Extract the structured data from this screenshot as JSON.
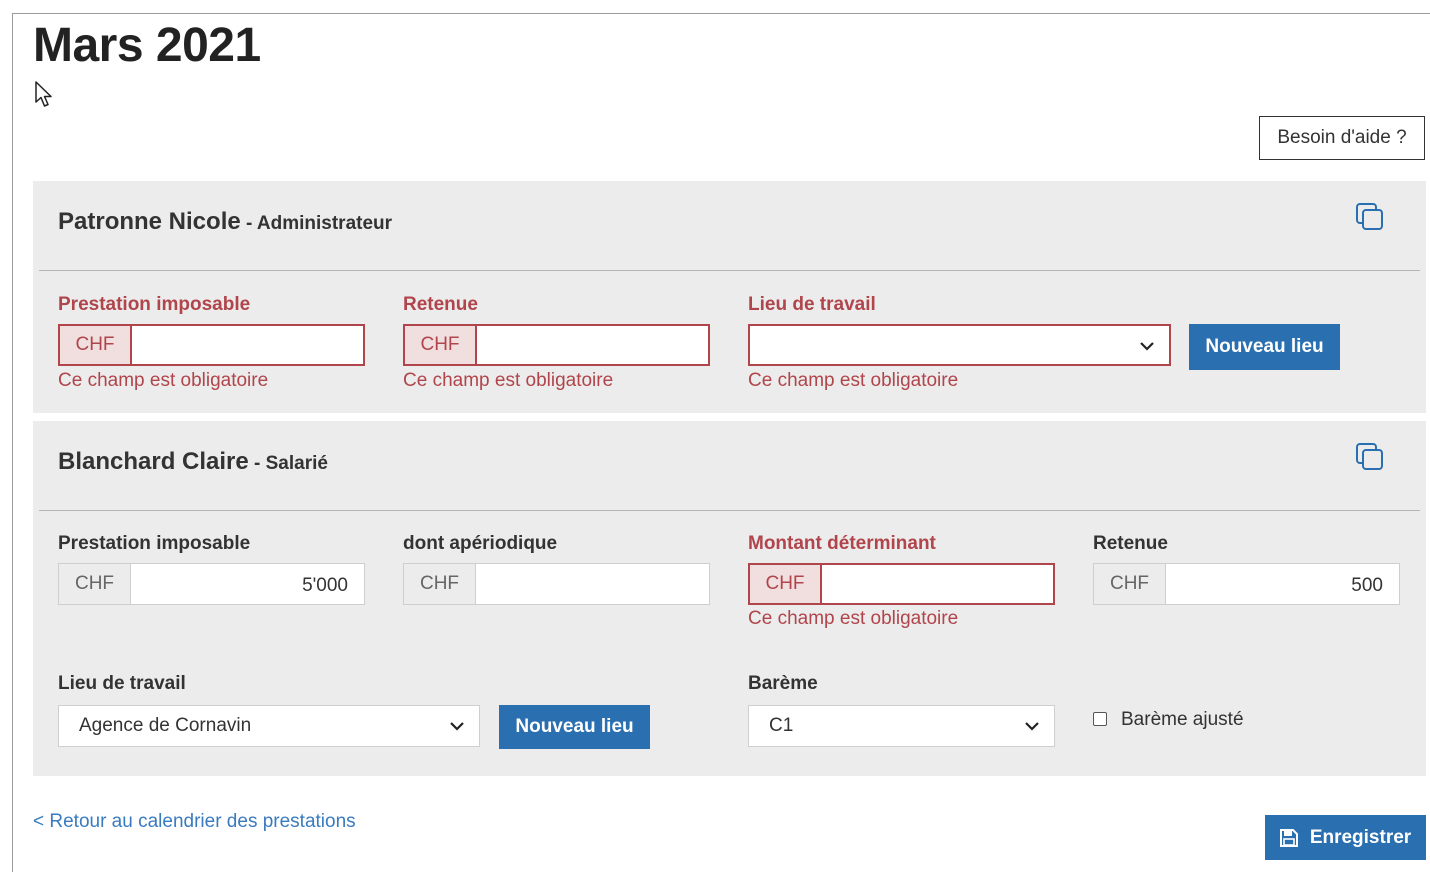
{
  "page": {
    "title": "Mars 2021",
    "help_label": "Besoin d'aide ?"
  },
  "colors": {
    "accent": "#2a6fb0",
    "error": "#b0454b",
    "card_bg": "#ececec",
    "link": "#3a7bbf"
  },
  "employees": [
    {
      "name": "Patronne Nicole",
      "role": " - Administrateur",
      "fields": {
        "prestation_label": "Prestation imposable",
        "prestation_currency": "CHF",
        "prestation_value": "",
        "prestation_error": "Ce champ est obligatoire",
        "retenue_label": "Retenue",
        "retenue_currency": "CHF",
        "retenue_value": "",
        "retenue_error": "Ce champ est obligatoire",
        "lieu_label": "Lieu de travail",
        "lieu_value": "",
        "lieu_error": "Ce champ est obligatoire",
        "nouveau_lieu_label": "Nouveau lieu"
      }
    },
    {
      "name": "Blanchard Claire",
      "role": " - Salarié",
      "fields": {
        "prestation_label": "Prestation imposable",
        "prestation_currency": "CHF",
        "prestation_value": "5'000",
        "aperiodique_label": "dont apériodique",
        "aperiodique_currency": "CHF",
        "aperiodique_value": "",
        "montant_label": "Montant déterminant",
        "montant_currency": "CHF",
        "montant_value": "",
        "montant_error": "Ce champ est obligatoire",
        "retenue_label": "Retenue",
        "retenue_currency": "CHF",
        "retenue_value": "500",
        "lieu_label": "Lieu de travail",
        "lieu_value": "Agence de Cornavin",
        "nouveau_lieu_label": "Nouveau lieu",
        "bareme_label": "Barème",
        "bareme_value": "C1",
        "bareme_ajuste_label": "Barème ajusté",
        "bareme_ajuste_checked": false
      }
    }
  ],
  "footer": {
    "back_link": "< Retour au calendrier des prestations",
    "save_label": "Enregistrer"
  },
  "icons": {
    "copy": "copy-icon",
    "chevron": "chevron-down-icon",
    "save": "floppy-disk-icon",
    "cursor": "mouse-pointer-icon"
  }
}
